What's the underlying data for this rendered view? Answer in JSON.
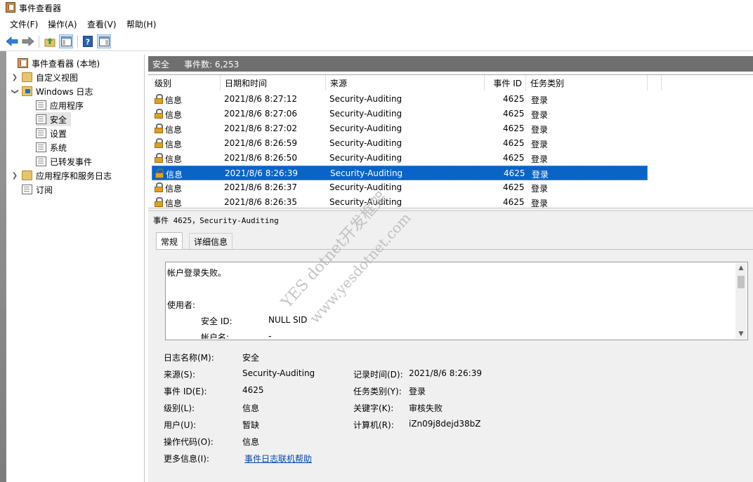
{
  "window": {
    "title": "事件查看器"
  },
  "menu": [
    "文件(F)",
    "操作(A)",
    "查看(V)",
    "帮助(H)"
  ],
  "toolbar_icons": [
    "back-arrow-icon",
    "forward-arrow-icon",
    "up-folder-icon",
    "show-hide-tree-icon",
    "help-icon",
    "action-pane-icon"
  ],
  "tree": {
    "root": "事件查看器 (本地)",
    "custom_views": "自定义视图",
    "windows_logs": "Windows 日志",
    "logs": [
      "应用程序",
      "安全",
      "设置",
      "系统",
      "已转发事件"
    ],
    "app_service_logs": "应用程序和服务日志",
    "subscriptions": "订阅"
  },
  "pane_header": {
    "name": "安全",
    "count_label": "事件数: 6,253"
  },
  "table": {
    "columns": [
      "级别",
      "日期和时间",
      "来源",
      "事件 ID",
      "任务类别"
    ],
    "rows": [
      {
        "level": "信息",
        "datetime": "2021/8/6 8:27:12",
        "source": "Security-Auditing",
        "id": "4625",
        "category": "登录"
      },
      {
        "level": "信息",
        "datetime": "2021/8/6 8:27:06",
        "source": "Security-Auditing",
        "id": "4625",
        "category": "登录"
      },
      {
        "level": "信息",
        "datetime": "2021/8/6 8:27:02",
        "source": "Security-Auditing",
        "id": "4625",
        "category": "登录"
      },
      {
        "level": "信息",
        "datetime": "2021/8/6 8:26:59",
        "source": "Security-Auditing",
        "id": "4625",
        "category": "登录"
      },
      {
        "level": "信息",
        "datetime": "2021/8/6 8:26:50",
        "source": "Security-Auditing",
        "id": "4625",
        "category": "登录"
      },
      {
        "level": "信息",
        "datetime": "2021/8/6 8:26:39",
        "source": "Security-Auditing",
        "id": "4625",
        "category": "登录"
      },
      {
        "level": "信息",
        "datetime": "2021/8/6 8:26:37",
        "source": "Security-Auditing",
        "id": "4625",
        "category": "登录"
      },
      {
        "level": "信息",
        "datetime": "2021/8/6 8:26:35",
        "source": "Security-Auditing",
        "id": "4625",
        "category": "登录"
      }
    ],
    "selected_index": 5
  },
  "detail": {
    "title": "事件 4625，Security-Auditing",
    "tabs": [
      "常规",
      "详细信息"
    ],
    "message": {
      "line1": "帐户登录失败。",
      "subject_label": "使用者:",
      "sid_label": "安全 ID:",
      "sid_value": "NULL SID",
      "account_label": "帐户名:",
      "account_value": "-"
    },
    "fields": {
      "log_name_label": "日志名称(M):",
      "log_name": "安全",
      "source_label": "来源(S):",
      "source": "Security-Auditing",
      "logged_label": "记录时间(D):",
      "logged": "2021/8/6 8:26:39",
      "event_id_label": "事件 ID(E):",
      "event_id": "4625",
      "task_label": "任务类别(Y):",
      "task": "登录",
      "level_label": "级别(L):",
      "level": "信息",
      "keywords_label": "关键字(K):",
      "keywords": "审核失败",
      "user_label": "用户(U):",
      "user": "暂缺",
      "computer_label": "计算机(R):",
      "computer": "iZn09j8dejd38bZ",
      "opcode_label": "操作代码(O):",
      "opcode": "信息",
      "more_info_label": "更多信息(I):",
      "more_info_link": "事件日志联机帮助"
    }
  },
  "watermark": {
    "line1": "YES dotnet开发框架",
    "line2": "www.yesdotnet.com"
  },
  "colors": {
    "selection": "#0a64c8",
    "header_bg": "#6f6f6f",
    "link": "#0645ad"
  }
}
